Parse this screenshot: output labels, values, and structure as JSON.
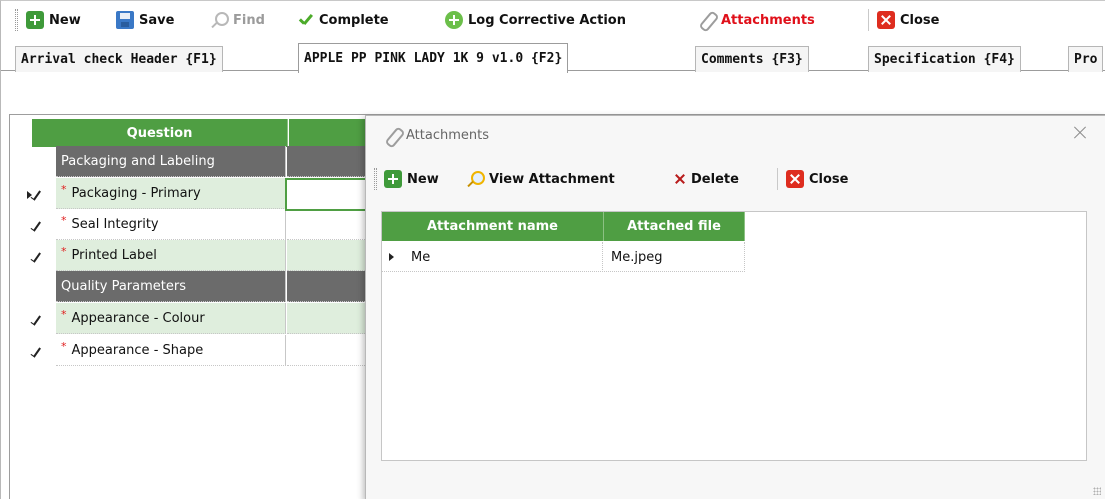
{
  "toolbar": {
    "new_label": "New",
    "save_label": "Save",
    "find_label": "Find",
    "complete_label": "Complete",
    "log_corrective_label": "Log Corrective Action",
    "attachments_label": "Attachments",
    "close_label": "Close"
  },
  "tabs": [
    {
      "label": "Arrival check Header {F1}"
    },
    {
      "label": "APPLE PP PINK LADY 1K 9 v1.0 {F2}"
    },
    {
      "label": "Comments {F3}"
    },
    {
      "label": "Specification {F4}"
    },
    {
      "label": "Pro"
    }
  ],
  "grid": {
    "header_question": "Question",
    "rows": [
      {
        "type": "group",
        "label": "Packaging and Labeling"
      },
      {
        "type": "item",
        "label": "Packaging - Primary",
        "required": "*"
      },
      {
        "type": "item",
        "label": "Seal Integrity",
        "required": "*"
      },
      {
        "type": "item",
        "label": "Printed Label",
        "required": "*"
      },
      {
        "type": "group",
        "label": "Quality Parameters"
      },
      {
        "type": "item",
        "label": "Appearance - Colour",
        "required": "*"
      },
      {
        "type": "item",
        "label": "Appearance - Shape",
        "required": "*"
      }
    ]
  },
  "dialog": {
    "title": "Attachments",
    "new_label": "New",
    "view_label": "View Attachment",
    "delete_label": "Delete",
    "close_label": "Close",
    "columns": [
      "Attachment name",
      "Attached file"
    ],
    "rows": [
      {
        "name": "Me",
        "file": "Me.jpeg"
      }
    ]
  },
  "colors": {
    "accent_green": "#4f9e43",
    "row_alt": "#dfeedd",
    "group_gray": "#6b6b6b",
    "attachments_red": "#e0101a"
  }
}
